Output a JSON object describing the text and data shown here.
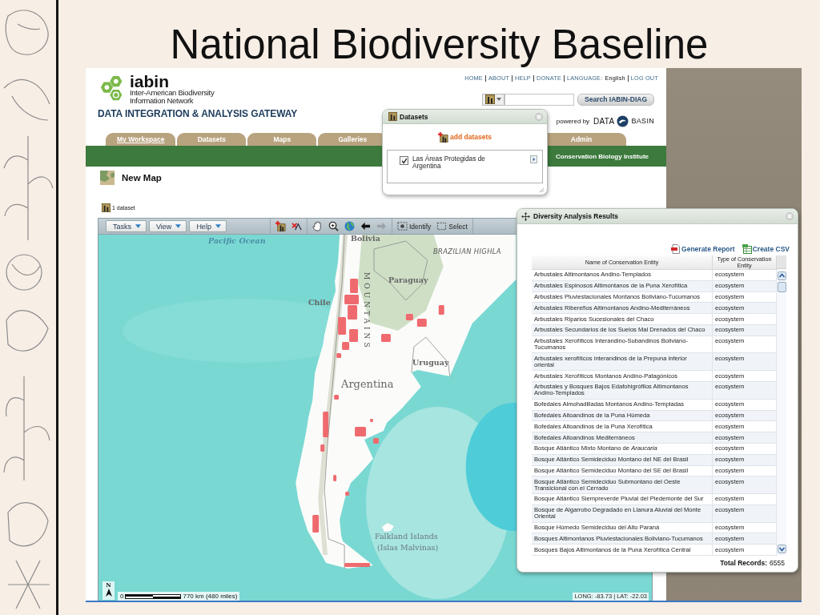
{
  "slide": {
    "title": "National Biodiversity Baseline"
  },
  "site": {
    "logo_name": "iabin",
    "logo_lines": [
      "Inter-American Biodiversity",
      "Information Network"
    ],
    "gateway_title": "DATA INTEGRATION & ANALYSIS GATEWAY",
    "top_links": [
      "HOME",
      "ABOUT",
      "HELP",
      "DONATE"
    ],
    "language": {
      "label": "LANGUAGE:",
      "value": "English"
    },
    "logout": "LOG OUT",
    "search_button": "Search IABIN-DIAG",
    "powered_by": {
      "label": "powered by",
      "brand_left": "DATA",
      "brand_right": "BASIN"
    },
    "tabs": [
      {
        "label": "My Workspace",
        "selected": true
      },
      {
        "label": "Datasets",
        "selected": false
      },
      {
        "label": "Maps",
        "selected": false
      },
      {
        "label": "Galleries",
        "selected": false
      },
      {
        "label": "Admin",
        "selected": false
      }
    ],
    "banner_credit": "Conservation Biology Institute"
  },
  "datasets_popup": {
    "title": "Datasets",
    "add_link": "add datasets",
    "items": [
      {
        "label": "Las Áreas Protegidas de Argentina",
        "checked": true
      }
    ]
  },
  "map_page": {
    "title": "New Map",
    "dataset_count": "1 dataset",
    "toolbar": {
      "menus": [
        "Tasks",
        "View",
        "Help"
      ],
      "history": [
        {
          "kind": "back",
          "disabled": false
        },
        {
          "kind": "forward",
          "disabled": true
        }
      ],
      "identify": "Identify",
      "select": "Select"
    },
    "map": {
      "labels": [
        {
          "kind": "ocean",
          "text": "Pacific Ocean"
        },
        {
          "kind": "country",
          "text": "Bolivia"
        },
        {
          "kind": "region",
          "text": "BRAZILIAN HIGHLA"
        },
        {
          "kind": "country",
          "text": "Paraguay"
        },
        {
          "kind": "country",
          "text": "Chile"
        },
        {
          "kind": "mountains",
          "text": "MOUNTAINS"
        },
        {
          "kind": "country",
          "text": "Uruguay"
        },
        {
          "kind": "main-country",
          "text": "Argentina"
        },
        {
          "kind": "island",
          "text": "Falkland Islands"
        },
        {
          "kind": "island",
          "text": "(Islas Malvinas)"
        }
      ],
      "north": "N",
      "scale_zero": "0",
      "scale_distance": "770 km (480 miles)",
      "coordinates": "LONG: -83.73 | LAT: -22.03"
    }
  },
  "results_panel": {
    "title": "Diversity Analysis Results",
    "actions": [
      {
        "kind": "pdf",
        "label": "Generate Report"
      },
      {
        "kind": "csv",
        "label": "Create CSV"
      }
    ],
    "columns": [
      "Name of Conservation Entity",
      "Type of Conservation Entity"
    ],
    "rows": [
      {
        "name": "Arbustales Altimontanos Andino-Templados",
        "type": "ecosystem"
      },
      {
        "name": "Arbustales Espinosos Altimontanos de la Puna Xerofítica",
        "type": "ecosystem"
      },
      {
        "name": "Arbustales Pluviestacionales Montanos Boliviano-Tucumanos",
        "type": "ecosystem"
      },
      {
        "name": "Arbustales Ribereños Altimontanos Andino-Mediterráneos",
        "type": "ecosystem"
      },
      {
        "name": "Arbustales Riparios Sucesionales del Chaco",
        "type": "ecosystem"
      },
      {
        "name": "Arbustales Secundarios de los Suelos Mal Drenados del Chaco",
        "type": "ecosystem"
      },
      {
        "name": "Arbustales Xerofíticos Interandino-Subandinos Boliviano-Tucumanos",
        "type": "ecosystem"
      },
      {
        "name": "Arbustales xerofíticos interandinos de la Prepuna inferior oriental",
        "type": "ecosystem"
      },
      {
        "name": "Arbustales Xerofíticos Montanos Andino-Patagónicos",
        "type": "ecosystem"
      },
      {
        "name": "Arbustales y Bosques Bajos Edafohigrófilos Altimontanos Andino-Templados",
        "type": "ecosystem"
      },
      {
        "name": "Bofedales Almohadilladas Montanos Andino-Templadas",
        "type": "ecosystem"
      },
      {
        "name": "Bofedales Altoandinos de la Puna Húmeda",
        "type": "ecosystem"
      },
      {
        "name": "Bofedales Altoandinos de la Puna Xerofítica",
        "type": "ecosystem"
      },
      {
        "name": "Bofedales Altoandinos Mediterráneos",
        "type": "ecosystem"
      },
      {
        "name": "Bosque Atlántico Mixto Montano de *Araucaria*",
        "type": "ecosystem"
      },
      {
        "name": "Bosque Atlántico Semideciduo Montano del NE del Brasil",
        "type": "ecosystem"
      },
      {
        "name": "Bosque Atlántico Semideciduo Montano del SE del Brasil",
        "type": "ecosystem"
      },
      {
        "name": "Bosque Atlántico Semideciduo Submontano del Oeste Transicional con el Cerrado",
        "type": "ecosystem"
      },
      {
        "name": "Bosque Atlántico Siempreverde Pluvial del Piedemonte del Sur",
        "type": "ecosystem"
      },
      {
        "name": "Bosque de Algarrobo Degradado en Llanura Aluvial del Monte Oriental",
        "type": "ecosystem"
      },
      {
        "name": "Bosque Húmedo Semideciduo del Alto Paraná",
        "type": "ecosystem"
      },
      {
        "name": "Bosques Altimontanos Pluviestacionales Boliviano-Tucumanos",
        "type": "ecosystem"
      },
      {
        "name": "Bosques Bajos Altimontanos de la Puna Xerofítica Central",
        "type": "ecosystem"
      }
    ],
    "total_label": "Total Records:",
    "total": "6555"
  }
}
